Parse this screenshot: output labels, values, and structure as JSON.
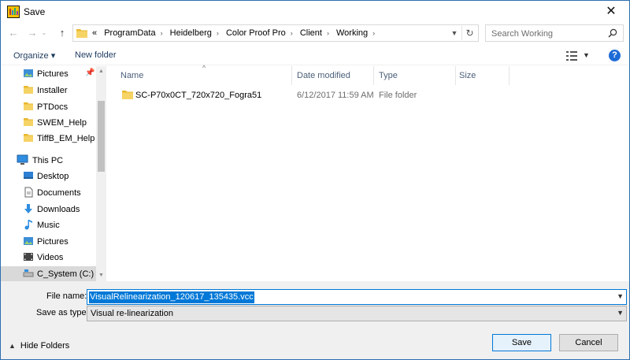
{
  "window": {
    "title": "Save",
    "close_label": "✕"
  },
  "address": {
    "overflow": "«",
    "crumbs": [
      "ProgramData",
      "Heidelberg",
      "Color Proof Pro",
      "Client",
      "Working"
    ]
  },
  "search": {
    "placeholder": "Search Working"
  },
  "toolbar": {
    "organize_label": "Organize ▾",
    "new_folder_label": "New folder"
  },
  "nav": {
    "quick": [
      "Pictures",
      "Installer",
      "PTDocs",
      "SWEM_Help",
      "TiffB_EM_Help"
    ],
    "this_pc": "This PC",
    "pc_items": [
      "Desktop",
      "Documents",
      "Downloads",
      "Music",
      "Pictures",
      "Videos",
      "C_System (C:)"
    ]
  },
  "columns": {
    "name": "Name",
    "date": "Date modified",
    "type": "Type",
    "size": "Size"
  },
  "files": [
    {
      "name": "SC-P70x0CT_720x720_Fogra51",
      "date": "6/12/2017 11:59 AM",
      "type": "File folder",
      "size": ""
    }
  ],
  "form": {
    "filename_label": "File name:",
    "filename_value": "VisualRelinearization_120617_135435.vcc",
    "type_label": "Save as type:",
    "type_value": "Visual re-linearization"
  },
  "footer": {
    "hide_folders": "Hide Folders",
    "save": "Save",
    "cancel": "Cancel"
  },
  "colors": {
    "accent": "#0078d7",
    "folder": "#f4c842"
  }
}
